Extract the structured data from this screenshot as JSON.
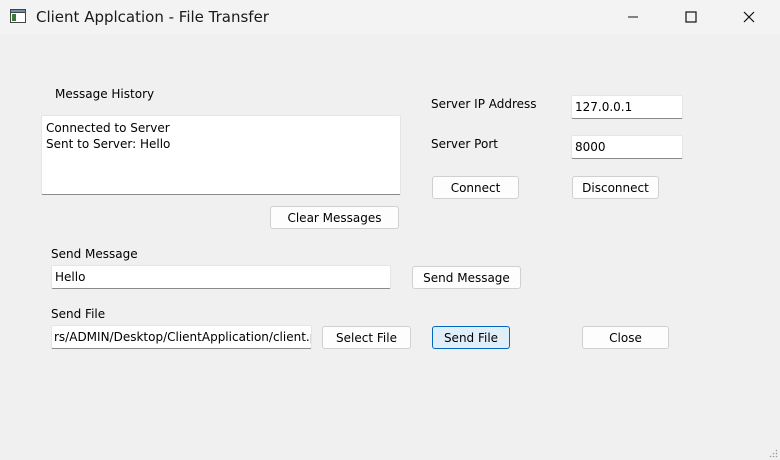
{
  "window": {
    "title": "Client Applcation - File Transfer",
    "controls": {
      "minimize": "–",
      "maximize": "☐",
      "close": "✕"
    }
  },
  "history": {
    "label": "Message History",
    "lines": [
      "Connected to Server",
      "Sent to Server: Hello"
    ],
    "clear_button": "Clear Messages"
  },
  "connection": {
    "ip_label": "Server IP Address",
    "ip_value": "127.0.0.1",
    "port_label": "Server Port",
    "port_value": "8000",
    "connect_button": "Connect",
    "disconnect_button": "Disconnect"
  },
  "message": {
    "label": "Send Message",
    "value": "Hello",
    "send_button": "Send Message"
  },
  "file": {
    "label": "Send File",
    "path_value": "rs/ADMIN/Desktop/ClientApplication/client.py",
    "select_button": "Select File",
    "send_button": "Send File",
    "close_button": "Close"
  },
  "colors": {
    "window_bg": "#f0f0f0",
    "focus_accent": "#0067c0"
  }
}
